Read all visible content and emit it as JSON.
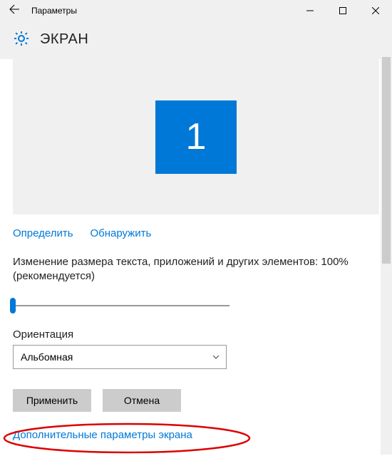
{
  "window": {
    "title": "Параметры"
  },
  "header": {
    "page_title": "ЭКРАН"
  },
  "monitor": {
    "number": "1"
  },
  "links": {
    "identify": "Определить",
    "detect": "Обнаружить"
  },
  "scale": {
    "label": "Изменение размера текста, приложений и других элементов: 100% (рекомендуется)"
  },
  "orientation": {
    "label": "Ориентация",
    "value": "Альбомная"
  },
  "buttons": {
    "apply": "Применить",
    "cancel": "Отмена"
  },
  "advanced": {
    "link": "Дополнительные параметры экрана"
  }
}
